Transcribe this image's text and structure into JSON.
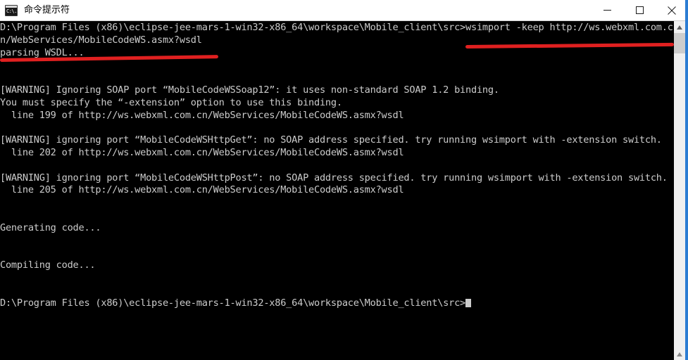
{
  "window": {
    "title": "命令提示符",
    "icon": "cmd-icon",
    "icon_glyph": "C:\\.",
    "controls": {
      "minimize_label": "Minimize",
      "maximize_label": "Maximize",
      "close_label": "Close"
    },
    "border_color": "#2b7cd3"
  },
  "console": {
    "background": "#000000",
    "foreground": "#cccccc",
    "lines": [
      "D:\\Program Files (x86)\\eclipse-jee-mars-1-win32-x86_64\\workspace\\Mobile_client\\src>wsimport -keep http://ws.webxml.com.c",
      "n/WebServices/MobileCodeWS.asmx?wsdl",
      "parsing WSDL...",
      "",
      "",
      "[WARNING] Ignoring SOAP port “MobileCodeWSSoap12”: it uses non-standard SOAP 1.2 binding.",
      "You must specify the “-extension” option to use this binding.",
      "  line 199 of http://ws.webxml.com.cn/WebServices/MobileCodeWS.asmx?wsdl",
      "",
      "[WARNING] ignoring port “MobileCodeWSHttpGet”: no SOAP address specified. try running wsimport with -extension switch.",
      "  line 202 of http://ws.webxml.com.cn/WebServices/MobileCodeWS.asmx?wsdl",
      "",
      "[WARNING] ignoring port “MobileCodeWSHttpPost”: no SOAP address specified. try running wsimport with -extension switch.",
      "  line 205 of http://ws.webxml.com.cn/WebServices/MobileCodeWS.asmx?wsdl",
      "",
      "",
      "Generating code...",
      "",
      "",
      "Compiling code...",
      "",
      "",
      "D:\\Program Files (x86)\\eclipse-jee-mars-1-win32-x86_64\\workspace\\Mobile_client\\src>"
    ],
    "prompt_path": "D:\\Program Files (x86)\\eclipse-jee-mars-1-win32-x86_64\\workspace\\Mobile_client\\src>",
    "command": "wsimport -keep http://ws.webxml.com.cn/WebServices/MobileCodeWS.asmx?wsdl",
    "cursor_visible": true
  },
  "annotations": {
    "color": "#e02020",
    "marks": [
      {
        "name": "underline-command",
        "target": "wsimport -keep http://ws.webxml.com.c"
      },
      {
        "name": "underline-url-continuation",
        "target": "n/WebServices/MobileCodeWS.asmx?wsdl"
      }
    ]
  },
  "scrollbar": {
    "up_arrow": "▲",
    "down_arrow": "▲",
    "thumb_position_pct": 0,
    "track_color": "#f0f0f0",
    "thumb_color": "#cdcdcd"
  }
}
